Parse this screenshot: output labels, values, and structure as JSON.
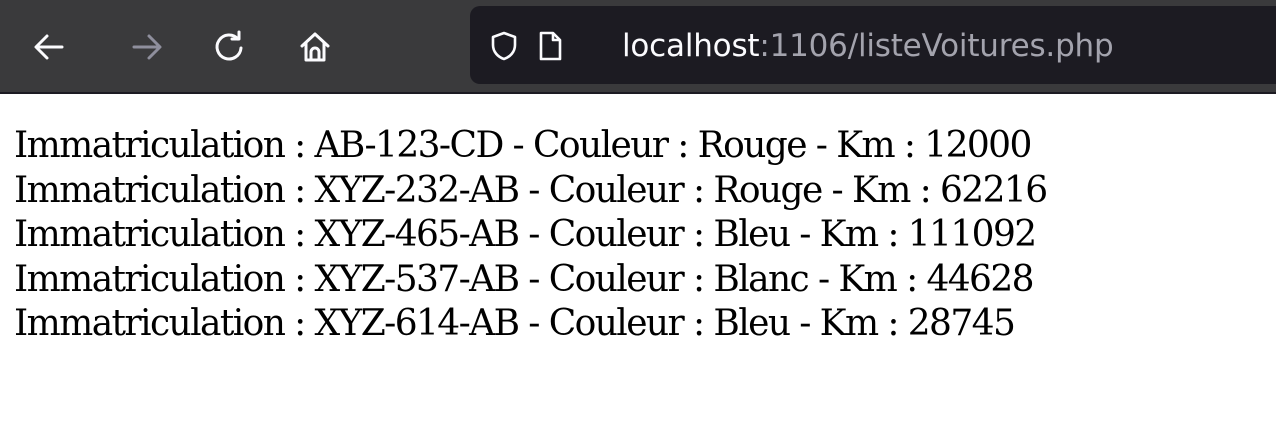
{
  "browser": {
    "url_host": "localhost",
    "url_rest": ":1106/listeVoitures.php",
    "colors": {
      "toolbar": "#3a3a3c",
      "urlbar": "#1c1b22",
      "url_host_text": "#fbfbfe",
      "url_rest_text": "#a3a3ad",
      "icon_active": "#fbfbfe",
      "icon_disabled": "#8f8f9d"
    },
    "icons": [
      "back-arrow-icon",
      "forward-arrow-icon",
      "reload-icon",
      "home-icon",
      "shield-icon",
      "page-icon"
    ]
  },
  "cars": [
    {
      "label_immat": "Immatriculation",
      "immatriculation": "AB-123-CD",
      "label_couleur": "Couleur",
      "couleur": "Rouge",
      "label_km": "Km",
      "km": "12000"
    },
    {
      "label_immat": "Immatriculation",
      "immatriculation": "XYZ-232-AB",
      "label_couleur": "Couleur",
      "couleur": "Rouge",
      "label_km": "Km",
      "km": "62216"
    },
    {
      "label_immat": "Immatriculation",
      "immatriculation": "XYZ-465-AB",
      "label_couleur": "Couleur",
      "couleur": "Bleu",
      "label_km": "Km",
      "km": "111092"
    },
    {
      "label_immat": "Immatriculation",
      "immatriculation": "XYZ-537-AB",
      "label_couleur": "Couleur",
      "couleur": "Blanc",
      "label_km": "Km",
      "km": "44628"
    },
    {
      "label_immat": "Immatriculation",
      "immatriculation": "XYZ-614-AB",
      "label_couleur": "Couleur",
      "couleur": "Bleu",
      "label_km": "Km",
      "km": "28745"
    }
  ]
}
